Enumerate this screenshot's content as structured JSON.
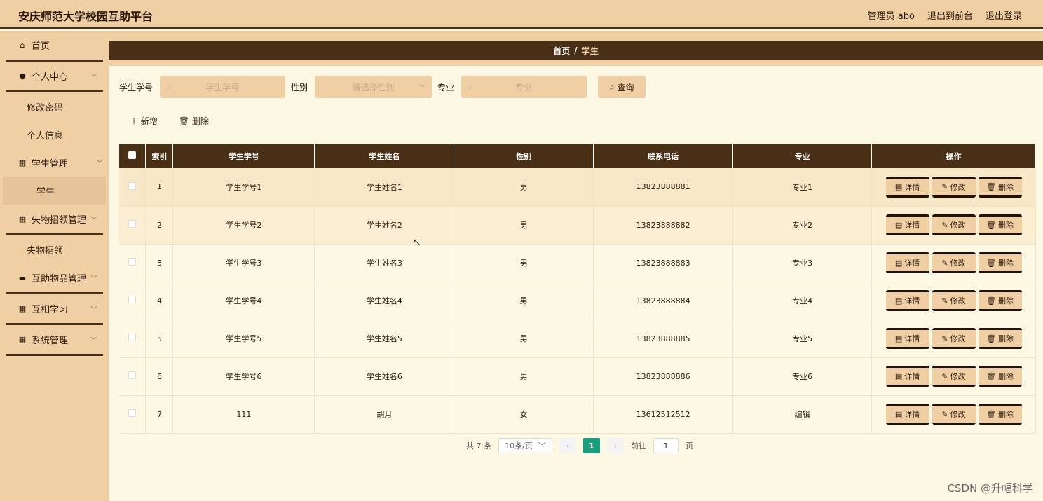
{
  "header": {
    "title": "安庆师范大学校园互助平台",
    "admin": "管理员 abo",
    "to_front": "退出到前台",
    "logout": "退出登录"
  },
  "sidebar": {
    "home": "首页",
    "personal": "个人中心",
    "change_pwd": "修改密码",
    "profile": "个人信息",
    "student_mgmt": "学生管理",
    "student": "学生",
    "lostfound_mgmt": "失物招领管理",
    "lostfound": "失物招领",
    "items_mgmt": "互助物品管理",
    "study": "互相学习",
    "system": "系统管理"
  },
  "breadcrumb": {
    "home": "首页",
    "sep": "/",
    "current": "学生"
  },
  "search": {
    "id_label": "学生学号",
    "id_placeholder": "学生学号",
    "gender_label": "性别",
    "gender_placeholder": "请选择性别",
    "major_label": "专业",
    "major_placeholder": "专业",
    "query": "查询"
  },
  "actions": {
    "add": "新增",
    "delete": "删除"
  },
  "table": {
    "headers": [
      "索引",
      "学生学号",
      "学生姓名",
      "性别",
      "联系电话",
      "专业",
      "操作"
    ],
    "rows": [
      [
        "1",
        "学生学号1",
        "学生姓名1",
        "男",
        "13823888881",
        "专业1"
      ],
      [
        "2",
        "学生学号2",
        "学生姓名2",
        "男",
        "13823888882",
        "专业2"
      ],
      [
        "3",
        "学生学号3",
        "学生姓名3",
        "男",
        "13823888883",
        "专业3"
      ],
      [
        "4",
        "学生学号4",
        "学生姓名4",
        "男",
        "13823888884",
        "专业4"
      ],
      [
        "5",
        "学生学号5",
        "学生姓名5",
        "男",
        "13823888885",
        "专业5"
      ],
      [
        "6",
        "学生学号6",
        "学生姓名6",
        "男",
        "13823888886",
        "专业6"
      ],
      [
        "7",
        "111",
        "胡月",
        "女",
        "13612512512",
        "编辑"
      ]
    ],
    "op_detail": "详情",
    "op_edit": "修改",
    "op_delete": "删除"
  },
  "pagination": {
    "total": "共 7 条",
    "page_size": "10条/页",
    "current": "1",
    "goto": "前往",
    "page_input": "1",
    "page_unit": "页"
  },
  "watermark": "CSDN @升幅科学",
  "colors": {
    "dark": "#4a2f17",
    "beige": "#f1cfa5",
    "bg": "#fdf8e4",
    "pager_active": "#1a9e7f"
  },
  "icons": [
    "home-icon",
    "user-icon",
    "grid-icon",
    "chevron-down-icon",
    "search-icon",
    "plus-icon",
    "trash-icon",
    "doc-icon",
    "edit-icon"
  ]
}
